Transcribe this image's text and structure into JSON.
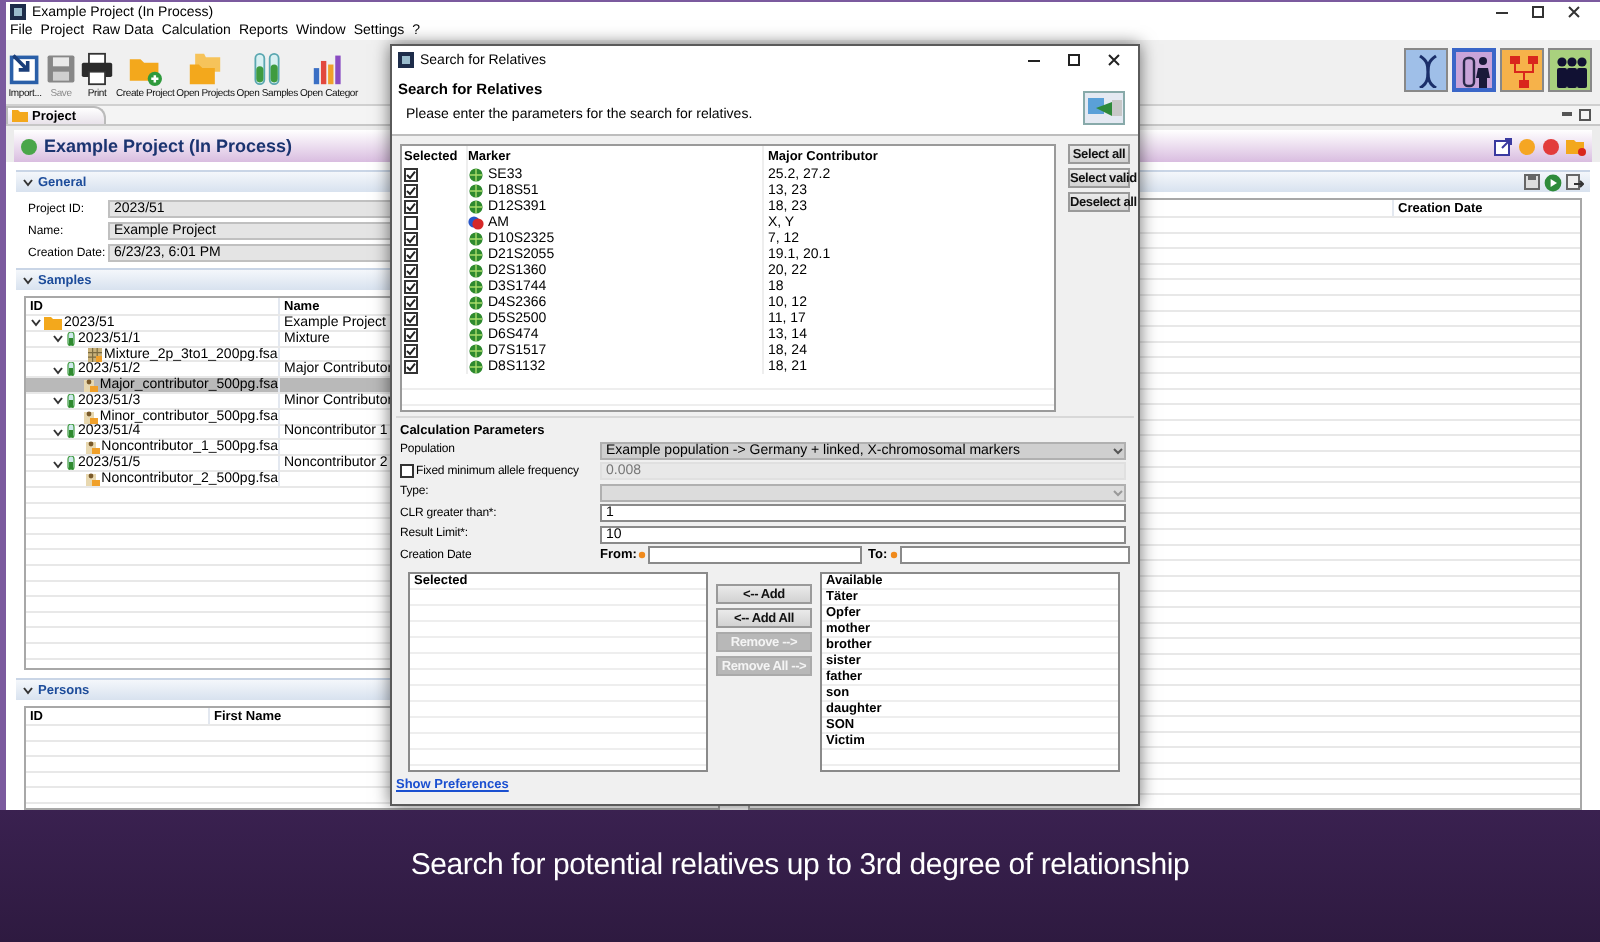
{
  "window": {
    "title": "Example Project (In Process)"
  },
  "menu": [
    "File",
    "Project",
    "Raw Data",
    "Calculation",
    "Reports",
    "Window",
    "Settings",
    "?"
  ],
  "toolbar": [
    {
      "kind": "import",
      "label": "Import...",
      "disabled": false
    },
    {
      "kind": "save",
      "label": "Save",
      "disabled": true
    },
    {
      "kind": "print",
      "label": "Print",
      "disabled": false
    },
    {
      "kind": "create",
      "label": "Create Project",
      "disabled": false
    },
    {
      "kind": "folders",
      "label": "Open Projects",
      "disabled": false
    },
    {
      "kind": "tubes",
      "label": "Open Samples",
      "disabled": false
    },
    {
      "kind": "chart",
      "label": "Open Categor",
      "disabled": false
    }
  ],
  "perspectives": [
    {
      "kind": "dna",
      "color": "#9fbfe8",
      "selected": false
    },
    {
      "kind": "persons",
      "color": "#c9a4d9",
      "selected": true
    },
    {
      "kind": "tree",
      "color": "#f6b24a",
      "selected": false
    },
    {
      "kind": "group",
      "color": "#a9d17e",
      "selected": false
    }
  ],
  "editor_tab": {
    "label": "Project"
  },
  "project": {
    "title": "Example Project (In Process)"
  },
  "general": {
    "title": "General",
    "fields": [
      {
        "label": "Project ID:",
        "value": "2023/51"
      },
      {
        "label": "Name:",
        "value": "Example Project"
      },
      {
        "label": "Creation Date:",
        "value": "6/23/23, 6:01 PM"
      }
    ]
  },
  "samples": {
    "title": "Samples",
    "columns": [
      "ID",
      "Name"
    ],
    "rows": [
      {
        "kind": "project",
        "id": "2023/51",
        "name": "Example Project",
        "expanded": true,
        "selected": false,
        "children": [
          {
            "kind": "sample",
            "id": "2023/51/1",
            "name": "Mixture",
            "expanded": true,
            "selected": false,
            "children": [
              {
                "kind": "mixture_file",
                "id": "Mixture_2p_3to1_200pg.fsa",
                "selected": false
              }
            ]
          },
          {
            "kind": "sample",
            "id": "2023/51/2",
            "name": "Major Contributor",
            "expanded": true,
            "selected": false,
            "children": [
              {
                "kind": "file",
                "id": "Major_contributor_500pg.fsa",
                "selected": true
              }
            ]
          },
          {
            "kind": "sample",
            "id": "2023/51/3",
            "name": "Minor Contributor",
            "expanded": true,
            "selected": false,
            "children": [
              {
                "kind": "file",
                "id": "Minor_contributor_500pg.fsa",
                "selected": false
              }
            ]
          },
          {
            "kind": "sample",
            "id": "2023/51/4",
            "name": "Noncontributor 1",
            "expanded": true,
            "selected": false,
            "children": [
              {
                "kind": "file",
                "id": "Noncontributor_1_500pg.fsa",
                "selected": false
              }
            ]
          },
          {
            "kind": "sample",
            "id": "2023/51/5",
            "name": "Noncontributor 2",
            "expanded": true,
            "selected": false,
            "children": [
              {
                "kind": "file",
                "id": "Noncontributor_2_500pg.fsa",
                "selected": false
              }
            ]
          }
        ]
      }
    ]
  },
  "details": {
    "columns": [
      "Creation Date"
    ]
  },
  "persons": {
    "title": "Persons",
    "columns": [
      "ID",
      "First Name"
    ]
  },
  "dialog": {
    "title": "Search for Relatives",
    "heading": "Search for Relatives",
    "description": "Please enter the parameters for the search for relatives.",
    "markers": {
      "columns": [
        "Selected",
        "Marker",
        "Major Contributor"
      ],
      "rows": [
        {
          "checked": true,
          "valid": true,
          "marker": "SE33",
          "value": "25.2, 27.2"
        },
        {
          "checked": true,
          "valid": true,
          "marker": "D18S51",
          "value": "13, 23"
        },
        {
          "checked": true,
          "valid": true,
          "marker": "D12S391",
          "value": "18, 23"
        },
        {
          "checked": false,
          "valid": false,
          "marker": "AM",
          "value": "X, Y"
        },
        {
          "checked": true,
          "valid": true,
          "marker": "D10S2325",
          "value": "7, 12"
        },
        {
          "checked": true,
          "valid": true,
          "marker": "D21S2055",
          "value": "19.1, 20.1"
        },
        {
          "checked": true,
          "valid": true,
          "marker": "D2S1360",
          "value": "20, 22"
        },
        {
          "checked": true,
          "valid": true,
          "marker": "D3S1744",
          "value": "18"
        },
        {
          "checked": true,
          "valid": true,
          "marker": "D4S2366",
          "value": "10, 12"
        },
        {
          "checked": true,
          "valid": true,
          "marker": "D5S2500",
          "value": "11, 17"
        },
        {
          "checked": true,
          "valid": true,
          "marker": "D6S474",
          "value": "13, 14"
        },
        {
          "checked": true,
          "valid": true,
          "marker": "D7S1517",
          "value": "18, 24"
        },
        {
          "checked": true,
          "valid": true,
          "marker": "D8S1132",
          "value": "18, 21"
        }
      ]
    },
    "marker_buttons": [
      "Select all",
      "Select valid",
      "Deselect all"
    ],
    "parameters": {
      "title": "Calculation Parameters",
      "population": {
        "label": "Population",
        "value": "Example population -> Germany + linked, X-chromosomal markers"
      },
      "min_frequency": {
        "label": "Fixed minimum allele frequency",
        "checked": false,
        "value": "0.008"
      },
      "type": {
        "label": "Type:",
        "disabled": true
      },
      "clr": {
        "label": "CLR greater than*:",
        "value": "1"
      },
      "result_limit": {
        "label": "Result Limit*:",
        "value": "10"
      },
      "creation_date": {
        "label": "Creation Date",
        "from_label": "From:",
        "to_label": "To:"
      }
    },
    "relations": {
      "selected_header": "Selected",
      "available_header": "Available",
      "available": [
        "Täter",
        "Opfer",
        "mother",
        "brother",
        "sister",
        "father",
        "son",
        "daughter",
        "SON",
        "Victim"
      ],
      "buttons": [
        {
          "label": "<-- Add",
          "disabled": false
        },
        {
          "label": "<-- Add All",
          "disabled": false
        },
        {
          "label": "Remove -->",
          "disabled": true
        },
        {
          "label": "Remove All -->",
          "disabled": true
        }
      ]
    },
    "link": "Show Preferences"
  },
  "caption": "Search for potential relatives up to 3rd degree of relationship"
}
